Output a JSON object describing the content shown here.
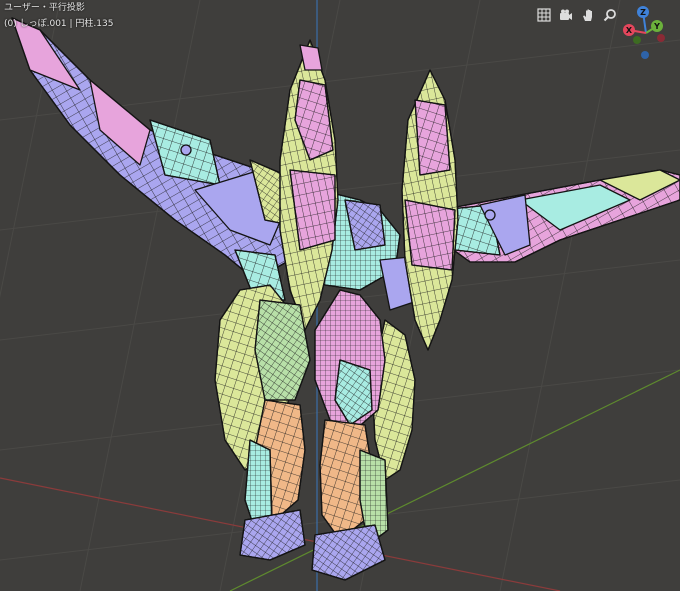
{
  "viewport": {
    "view_label": "ユーザー・平行投影",
    "object_info": "(0) しっぽ.001 | 円柱.135"
  },
  "nav_tools": {
    "icons": [
      "grid-icon",
      "camera-icon",
      "hand-pan-icon",
      "zoom-icon"
    ]
  },
  "axis_gizmo": {
    "x_label": "X",
    "y_label": "Y",
    "z_label": "Z",
    "colors": {
      "x": "#e4465c",
      "y": "#6bb13b",
      "z": "#3f82d9"
    }
  },
  "colors": {
    "background": "#3f3e3c",
    "grid_line": "#4b4a47",
    "x_axis_line": "#8a3b3b",
    "y_axis_line": "#5e8a2e",
    "z_axis_line": "#3a6ea8",
    "wire": "#1a1a1a",
    "patch_purple": "#aaa6ef",
    "patch_pink": "#e7a4dc",
    "patch_yellow": "#dbe79a",
    "patch_cyan": "#a8ece2",
    "patch_green": "#b8e0a8",
    "patch_orange": "#f0b888",
    "patch_mint": "#bfe8b8"
  }
}
